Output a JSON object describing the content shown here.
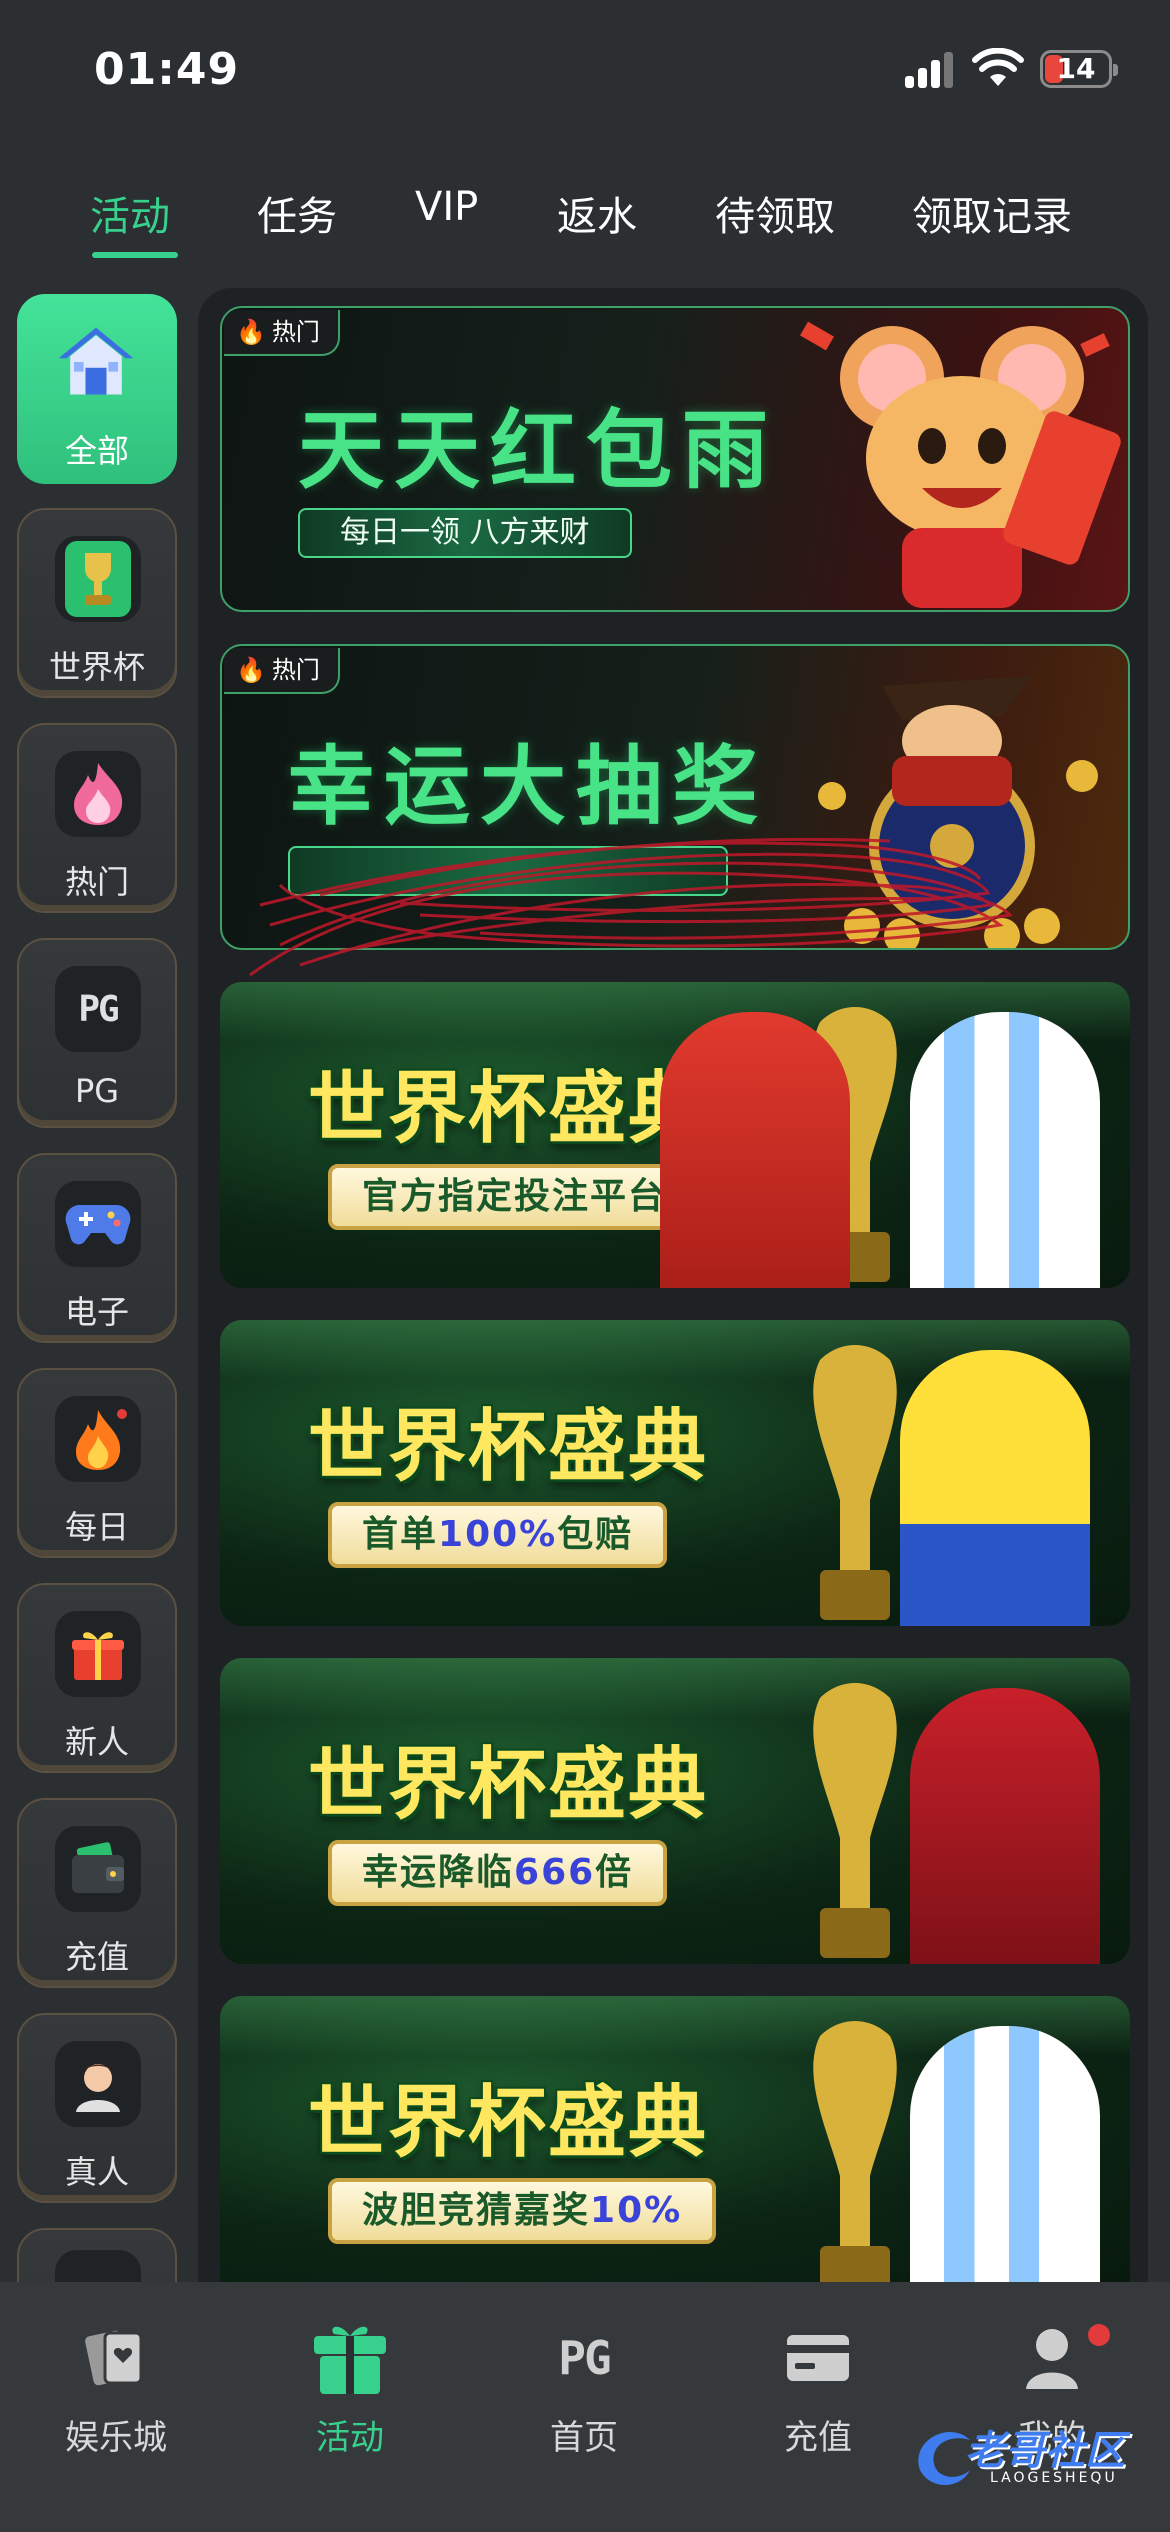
{
  "status_bar": {
    "time": "01:49",
    "battery": "14"
  },
  "top_tabs": [
    {
      "label": "活动",
      "active": true
    },
    {
      "label": "任务"
    },
    {
      "label": "VIP"
    },
    {
      "label": "返水"
    },
    {
      "label": "待领取"
    },
    {
      "label": "领取记录"
    }
  ],
  "side_menu": [
    {
      "label": "全部",
      "icon": "house-icon",
      "active": true
    },
    {
      "label": "世界杯",
      "icon": "trophy-icon"
    },
    {
      "label": "热门",
      "icon": "flame-icon"
    },
    {
      "label": "PG",
      "icon": "pg-logo-icon",
      "mark": "PG"
    },
    {
      "label": "电子",
      "icon": "gamepad-icon"
    },
    {
      "label": "每日",
      "icon": "fire-icon"
    },
    {
      "label": "新人",
      "icon": "gift-icon"
    },
    {
      "label": "充值",
      "icon": "wallet-icon"
    },
    {
      "label": "真人",
      "icon": "live-dealer-icon"
    }
  ],
  "banners": {
    "hot_tag": "热门",
    "red_envelope": {
      "title": "天天红包雨",
      "subtitle": "每日一领 八方来财"
    },
    "lucky_draw": {
      "title": "幸运大抽奖"
    },
    "world_cup": [
      {
        "title": "世界杯盛典",
        "sub_a": "官方指定投注平台",
        "sub_hl": "",
        "sub_b": ""
      },
      {
        "title": "世界杯盛典",
        "sub_a": "首单",
        "sub_hl": "100%",
        "sub_b": "包赔"
      },
      {
        "title": "世界杯盛典",
        "sub_a": "幸运降临",
        "sub_hl": "666",
        "sub_b": "倍"
      },
      {
        "title": "世界杯盛典",
        "sub_a": "波胆竞猜嘉奖",
        "sub_hl": "10%",
        "sub_b": ""
      }
    ]
  },
  "bottom_nav": [
    {
      "label": "娱乐城",
      "icon": "cards-icon"
    },
    {
      "label": "活动",
      "icon": "gift-box-icon",
      "active": true
    },
    {
      "label": "首页",
      "icon": "pg-home-icon",
      "mark": "PG"
    },
    {
      "label": "充值",
      "icon": "card-icon"
    },
    {
      "label": "我的",
      "icon": "user-icon"
    }
  ],
  "watermark": {
    "text": "老哥社区",
    "small": "LAOGESHEQU"
  },
  "colors": {
    "accent": "#37d08c",
    "background": "#2b2f31",
    "panel": "#1f2224",
    "badge": "#e33b3b"
  }
}
